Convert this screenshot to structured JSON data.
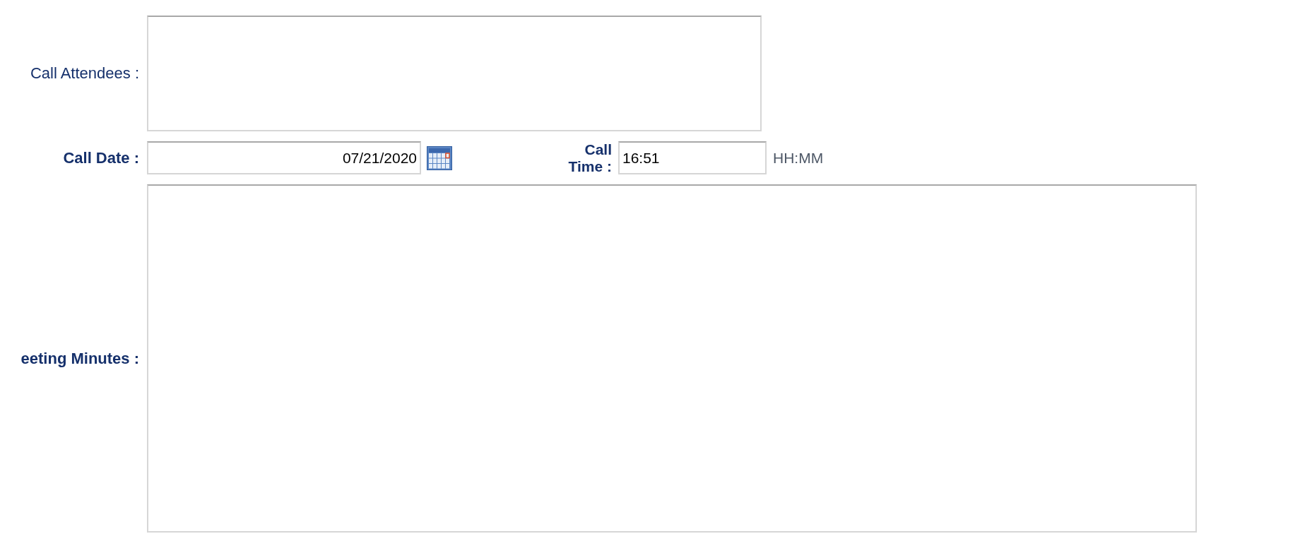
{
  "fields": [
    {
      "kind": "textarea",
      "label": "Call Attendees :",
      "bold": false
    },
    {
      "kind": "datetime",
      "label": "Call Date :",
      "bold": true,
      "value": "07/21/2020",
      "time_label": [
        "Call",
        "Time :"
      ],
      "time_value": "16:51",
      "time_hint": "HH:MM"
    },
    {
      "kind": "bigtextarea",
      "label": "eeting Minutes :",
      "bold": true
    }
  ]
}
